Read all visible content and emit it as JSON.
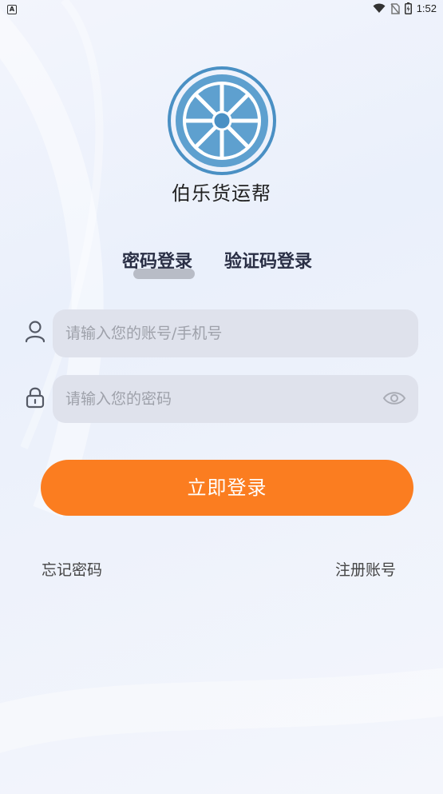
{
  "status_bar": {
    "left_badge": "A",
    "time": "1:52"
  },
  "app": {
    "name": "伯乐货运帮"
  },
  "tabs": [
    {
      "label": "密码登录",
      "selected": true
    },
    {
      "label": "验证码登录",
      "selected": false
    }
  ],
  "form": {
    "account_placeholder": "请输入您的账号/手机号",
    "password_placeholder": "请输入您的密码"
  },
  "login_button": "立即登录",
  "links": {
    "forgot": "忘记密码",
    "register": "注册账号"
  },
  "colors": {
    "accent": "#fb7d20",
    "logo_blue": "#4a90c4",
    "field_bg": "#dfe2ec"
  },
  "icons": {
    "account": "user-icon",
    "password": "lock-icon",
    "visibility": "eye-icon"
  }
}
